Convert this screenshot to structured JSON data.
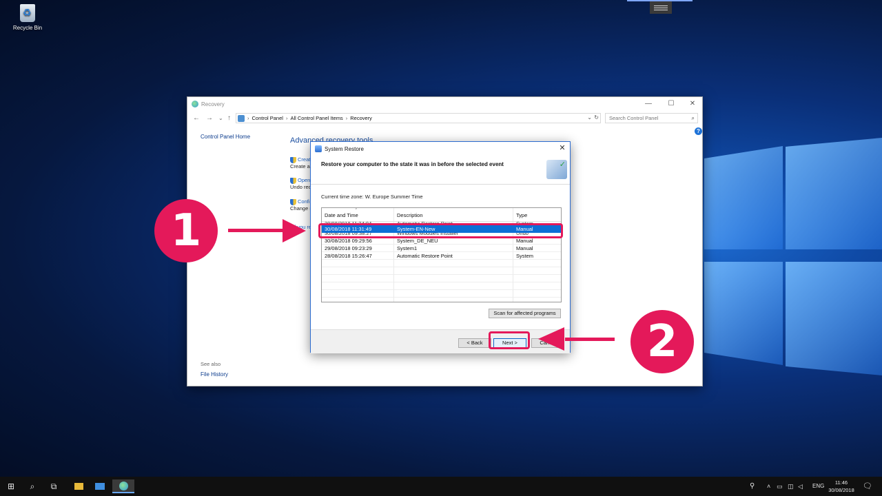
{
  "desktop": {
    "recycle_bin_label": "Recycle Bin"
  },
  "cp_window": {
    "title": "Recovery",
    "min": "—",
    "max": "☐",
    "close": "✕",
    "nav_back": "←",
    "nav_forward": "→",
    "nav_recent": "⌄",
    "nav_up": "↑",
    "breadcrumb": [
      "Control Panel",
      "All Control Panel Items",
      "Recovery"
    ],
    "breadcrumb_sep": "›",
    "addr_dropdown": "⌄",
    "addr_refresh": "↻",
    "search_placeholder": "Search Control Panel",
    "search_icon": "⌕",
    "help": "?",
    "sidebar_home": "Control Panel Home",
    "heading": "Advanced recovery tools",
    "items": [
      {
        "link": "Creat",
        "desc": "Create a"
      },
      {
        "link": "Open",
        "desc": "Undo rec"
      },
      {
        "link": "Confi",
        "desc": "Change r"
      }
    ],
    "hidden_link": "If you re",
    "see_also": "See also",
    "file_history": "File History"
  },
  "dialog": {
    "title": "System Restore",
    "close": "✕",
    "header": "Restore your computer to the state it was in before the selected event",
    "timezone": "Current time zone: W. Europe Summer Time",
    "columns": [
      "Date and Time",
      "Description",
      "Type"
    ],
    "sort_glyph": "˅",
    "rows": [
      {
        "date": "30/08/2018 11:34:04",
        "desc": "Automatic Restore Point",
        "type": "System"
      },
      {
        "date": "30/08/2018 11:31:49",
        "desc": "System-EN-New",
        "type": "Manual"
      },
      {
        "date": "30/08/2018 09:38:27",
        "desc": "Windows Modules Installer",
        "type": "Undo"
      },
      {
        "date": "30/08/2018 09:29:56",
        "desc": "System_DE_NEU",
        "type": "Manual"
      },
      {
        "date": "29/08/2018 09:23:29",
        "desc": "System1",
        "type": "Manual"
      },
      {
        "date": "28/08/2018 15:26:47",
        "desc": "Automatic Restore Point",
        "type": "System"
      }
    ],
    "scan_button": "Scan for affected programs",
    "back_button": "< Back",
    "next_button": "Next >",
    "cancel_button": "Cancel"
  },
  "annotations": {
    "step1": "1",
    "step2": "2",
    "color": "#e4195a"
  },
  "taskbar": {
    "start_icon": "⊞",
    "search_icon": "⌕",
    "taskview_icon": "⧉",
    "chevron": "˄",
    "language": "ENG",
    "time": "11:46",
    "date": "30/08/2018"
  }
}
